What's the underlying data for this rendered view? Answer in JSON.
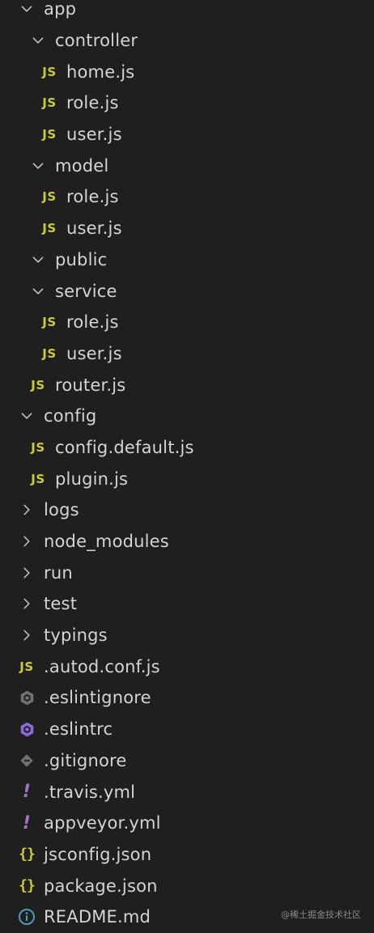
{
  "explorer": {
    "items": [
      {
        "label": "app",
        "type": "folder-open",
        "depth": 0,
        "icon": "chevron-down-icon"
      },
      {
        "label": "controller",
        "type": "folder-open",
        "depth": 1,
        "icon": "chevron-down-icon"
      },
      {
        "label": "home.js",
        "type": "js",
        "depth": 2,
        "icon": "js-file-icon"
      },
      {
        "label": "role.js",
        "type": "js",
        "depth": 2,
        "icon": "js-file-icon"
      },
      {
        "label": "user.js",
        "type": "js",
        "depth": 2,
        "icon": "js-file-icon"
      },
      {
        "label": "model",
        "type": "folder-open",
        "depth": 1,
        "icon": "chevron-down-icon"
      },
      {
        "label": "role.js",
        "type": "js",
        "depth": 2,
        "icon": "js-file-icon"
      },
      {
        "label": "user.js",
        "type": "js",
        "depth": 2,
        "icon": "js-file-icon"
      },
      {
        "label": "public",
        "type": "folder-open",
        "depth": 1,
        "icon": "chevron-down-icon"
      },
      {
        "label": "service",
        "type": "folder-open",
        "depth": 1,
        "icon": "chevron-down-icon"
      },
      {
        "label": "role.js",
        "type": "js",
        "depth": 2,
        "icon": "js-file-icon"
      },
      {
        "label": "user.js",
        "type": "js",
        "depth": 2,
        "icon": "js-file-icon"
      },
      {
        "label": "router.js",
        "type": "js",
        "depth": 1,
        "icon": "js-file-icon"
      },
      {
        "label": "config",
        "type": "folder-open",
        "depth": 0,
        "icon": "chevron-down-icon"
      },
      {
        "label": "config.default.js",
        "type": "js",
        "depth": 1,
        "icon": "js-file-icon"
      },
      {
        "label": "plugin.js",
        "type": "js",
        "depth": 1,
        "icon": "js-file-icon"
      },
      {
        "label": "logs",
        "type": "folder-closed",
        "depth": 0,
        "icon": "chevron-right-icon"
      },
      {
        "label": "node_modules",
        "type": "folder-closed",
        "depth": 0,
        "icon": "chevron-right-icon"
      },
      {
        "label": "run",
        "type": "folder-closed",
        "depth": 0,
        "icon": "chevron-right-icon"
      },
      {
        "label": "test",
        "type": "folder-closed",
        "depth": 0,
        "icon": "chevron-right-icon"
      },
      {
        "label": "typings",
        "type": "folder-closed",
        "depth": 0,
        "icon": "chevron-right-icon"
      },
      {
        "label": ".autod.conf.js",
        "type": "js",
        "depth": 0,
        "icon": "js-file-icon"
      },
      {
        "label": ".eslintignore",
        "type": "eslintignore",
        "depth": 0,
        "icon": "eslint-gray-icon"
      },
      {
        "label": ".eslintrc",
        "type": "eslintrc",
        "depth": 0,
        "icon": "eslint-purple-icon"
      },
      {
        "label": ".gitignore",
        "type": "git",
        "depth": 0,
        "icon": "git-icon"
      },
      {
        "label": ".travis.yml",
        "type": "yml",
        "depth": 0,
        "icon": "yml-file-icon"
      },
      {
        "label": "appveyor.yml",
        "type": "yml",
        "depth": 0,
        "icon": "yml-file-icon"
      },
      {
        "label": "jsconfig.json",
        "type": "json",
        "depth": 0,
        "icon": "json-file-icon"
      },
      {
        "label": "package.json",
        "type": "json",
        "depth": 0,
        "icon": "json-file-icon"
      },
      {
        "label": "README.md",
        "type": "info",
        "depth": 0,
        "icon": "info-icon"
      }
    ]
  },
  "icon_text": {
    "js": "JS",
    "yml": "!",
    "json": "{}"
  },
  "colors": {
    "background": "#1f1f1f",
    "text": "#d4d4d4",
    "js": "#cbcb41",
    "yml": "#a074c4",
    "json": "#cbcb41",
    "eslintrc": "#8d6ad8",
    "eslintignore": "#6d7278",
    "git": "#6d7278",
    "info": "#519aba",
    "chevron": "#c5c5c5"
  },
  "watermark": "@稀土掘金技术社区"
}
